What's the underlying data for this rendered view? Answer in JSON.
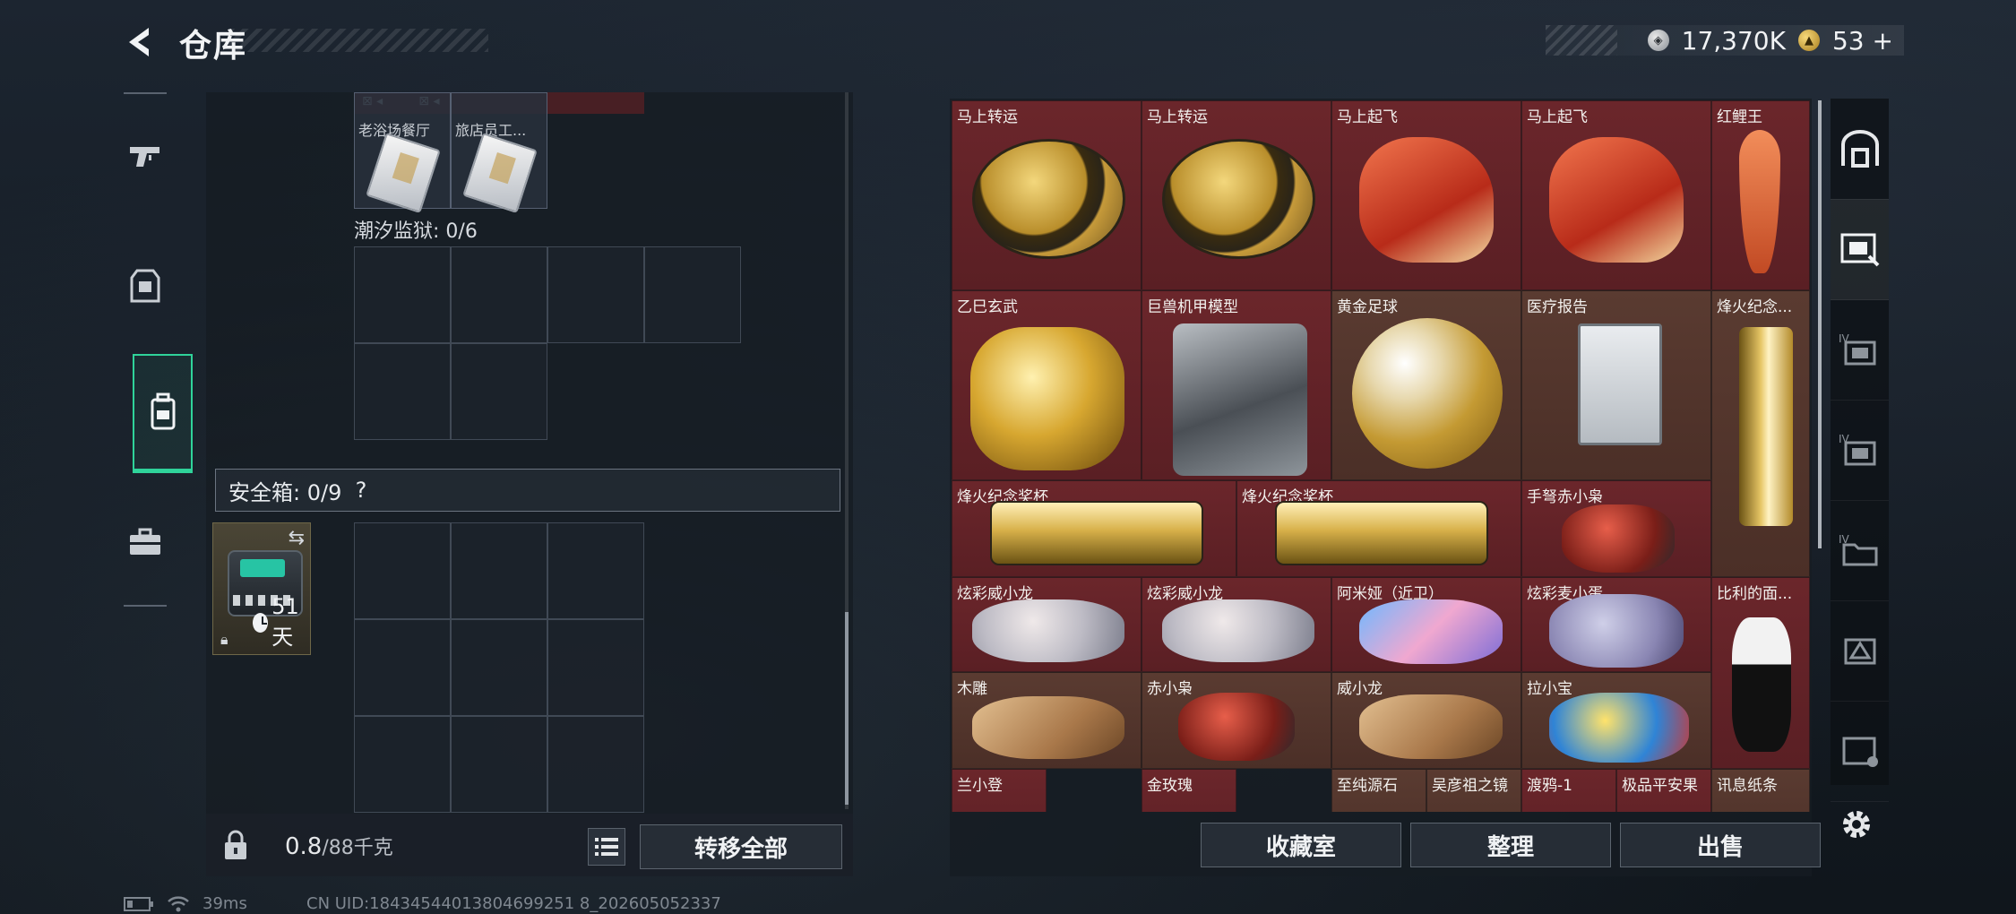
{
  "header": {
    "title": "仓库"
  },
  "currency": [
    {
      "icon": "silver-coin-icon",
      "value": "17,370K"
    },
    {
      "icon": "gold-coin-icon",
      "value": "53",
      "suffix": "+"
    }
  ],
  "left_tabs": [
    {
      "icon": "pistol-icon",
      "active": false
    },
    {
      "icon": "armor-icon",
      "active": false
    },
    {
      "icon": "backpack-icon",
      "active": true
    },
    {
      "icon": "briefcase-icon",
      "active": false
    }
  ],
  "inventory": {
    "top_items": [
      {
        "label": "老浴场餐厅"
      },
      {
        "label": "旅店员工..."
      }
    ],
    "section_tide_prison": "潮汐监狱: 0/6",
    "safebox": {
      "label": "安全箱: 0/9",
      "help": "?",
      "timer": "51天"
    }
  },
  "footer_left": {
    "weight": "0.8",
    "weight_max": "/88千克",
    "transfer_all": "转移全部"
  },
  "warehouse": {
    "items": [
      {
        "name": "马上转运"
      },
      {
        "name": "马上转运"
      },
      {
        "name": "马上起飞"
      },
      {
        "name": "马上起飞"
      },
      {
        "name": "红鲤王"
      },
      {
        "name": "乙巳玄武"
      },
      {
        "name": "巨兽机甲模型"
      },
      {
        "name": "黄金足球"
      },
      {
        "name": "医疗报告"
      },
      {
        "name": "烽火纪念..."
      },
      {
        "name": "烽火纪念奖杯"
      },
      {
        "name": "烽火纪念奖杯"
      },
      {
        "name": "手弩赤小枭"
      },
      {
        "name": "炫彩威小龙"
      },
      {
        "name": "炫彩威小龙"
      },
      {
        "name": "阿米娅（近卫）"
      },
      {
        "name": "炫彩麦小蛋"
      },
      {
        "name": "比利的面..."
      },
      {
        "name": "木雕"
      },
      {
        "name": "赤小枭"
      },
      {
        "name": "威小龙"
      },
      {
        "name": "拉小宝"
      },
      {
        "name": "兰小登"
      },
      {
        "name": "金玫瑰"
      },
      {
        "name": "至纯源石"
      },
      {
        "name": "吴彦祖之镜"
      },
      {
        "name": "渡鸦-1"
      },
      {
        "name": "极品平安果"
      },
      {
        "name": "讯息纸条"
      }
    ]
  },
  "footer_right": {
    "collection": "收藏室",
    "organize": "整理",
    "sell": "出售"
  },
  "status_bar": {
    "ping": "39ms",
    "uid": "CN UID:18434544013804699251 8_202605052337"
  }
}
